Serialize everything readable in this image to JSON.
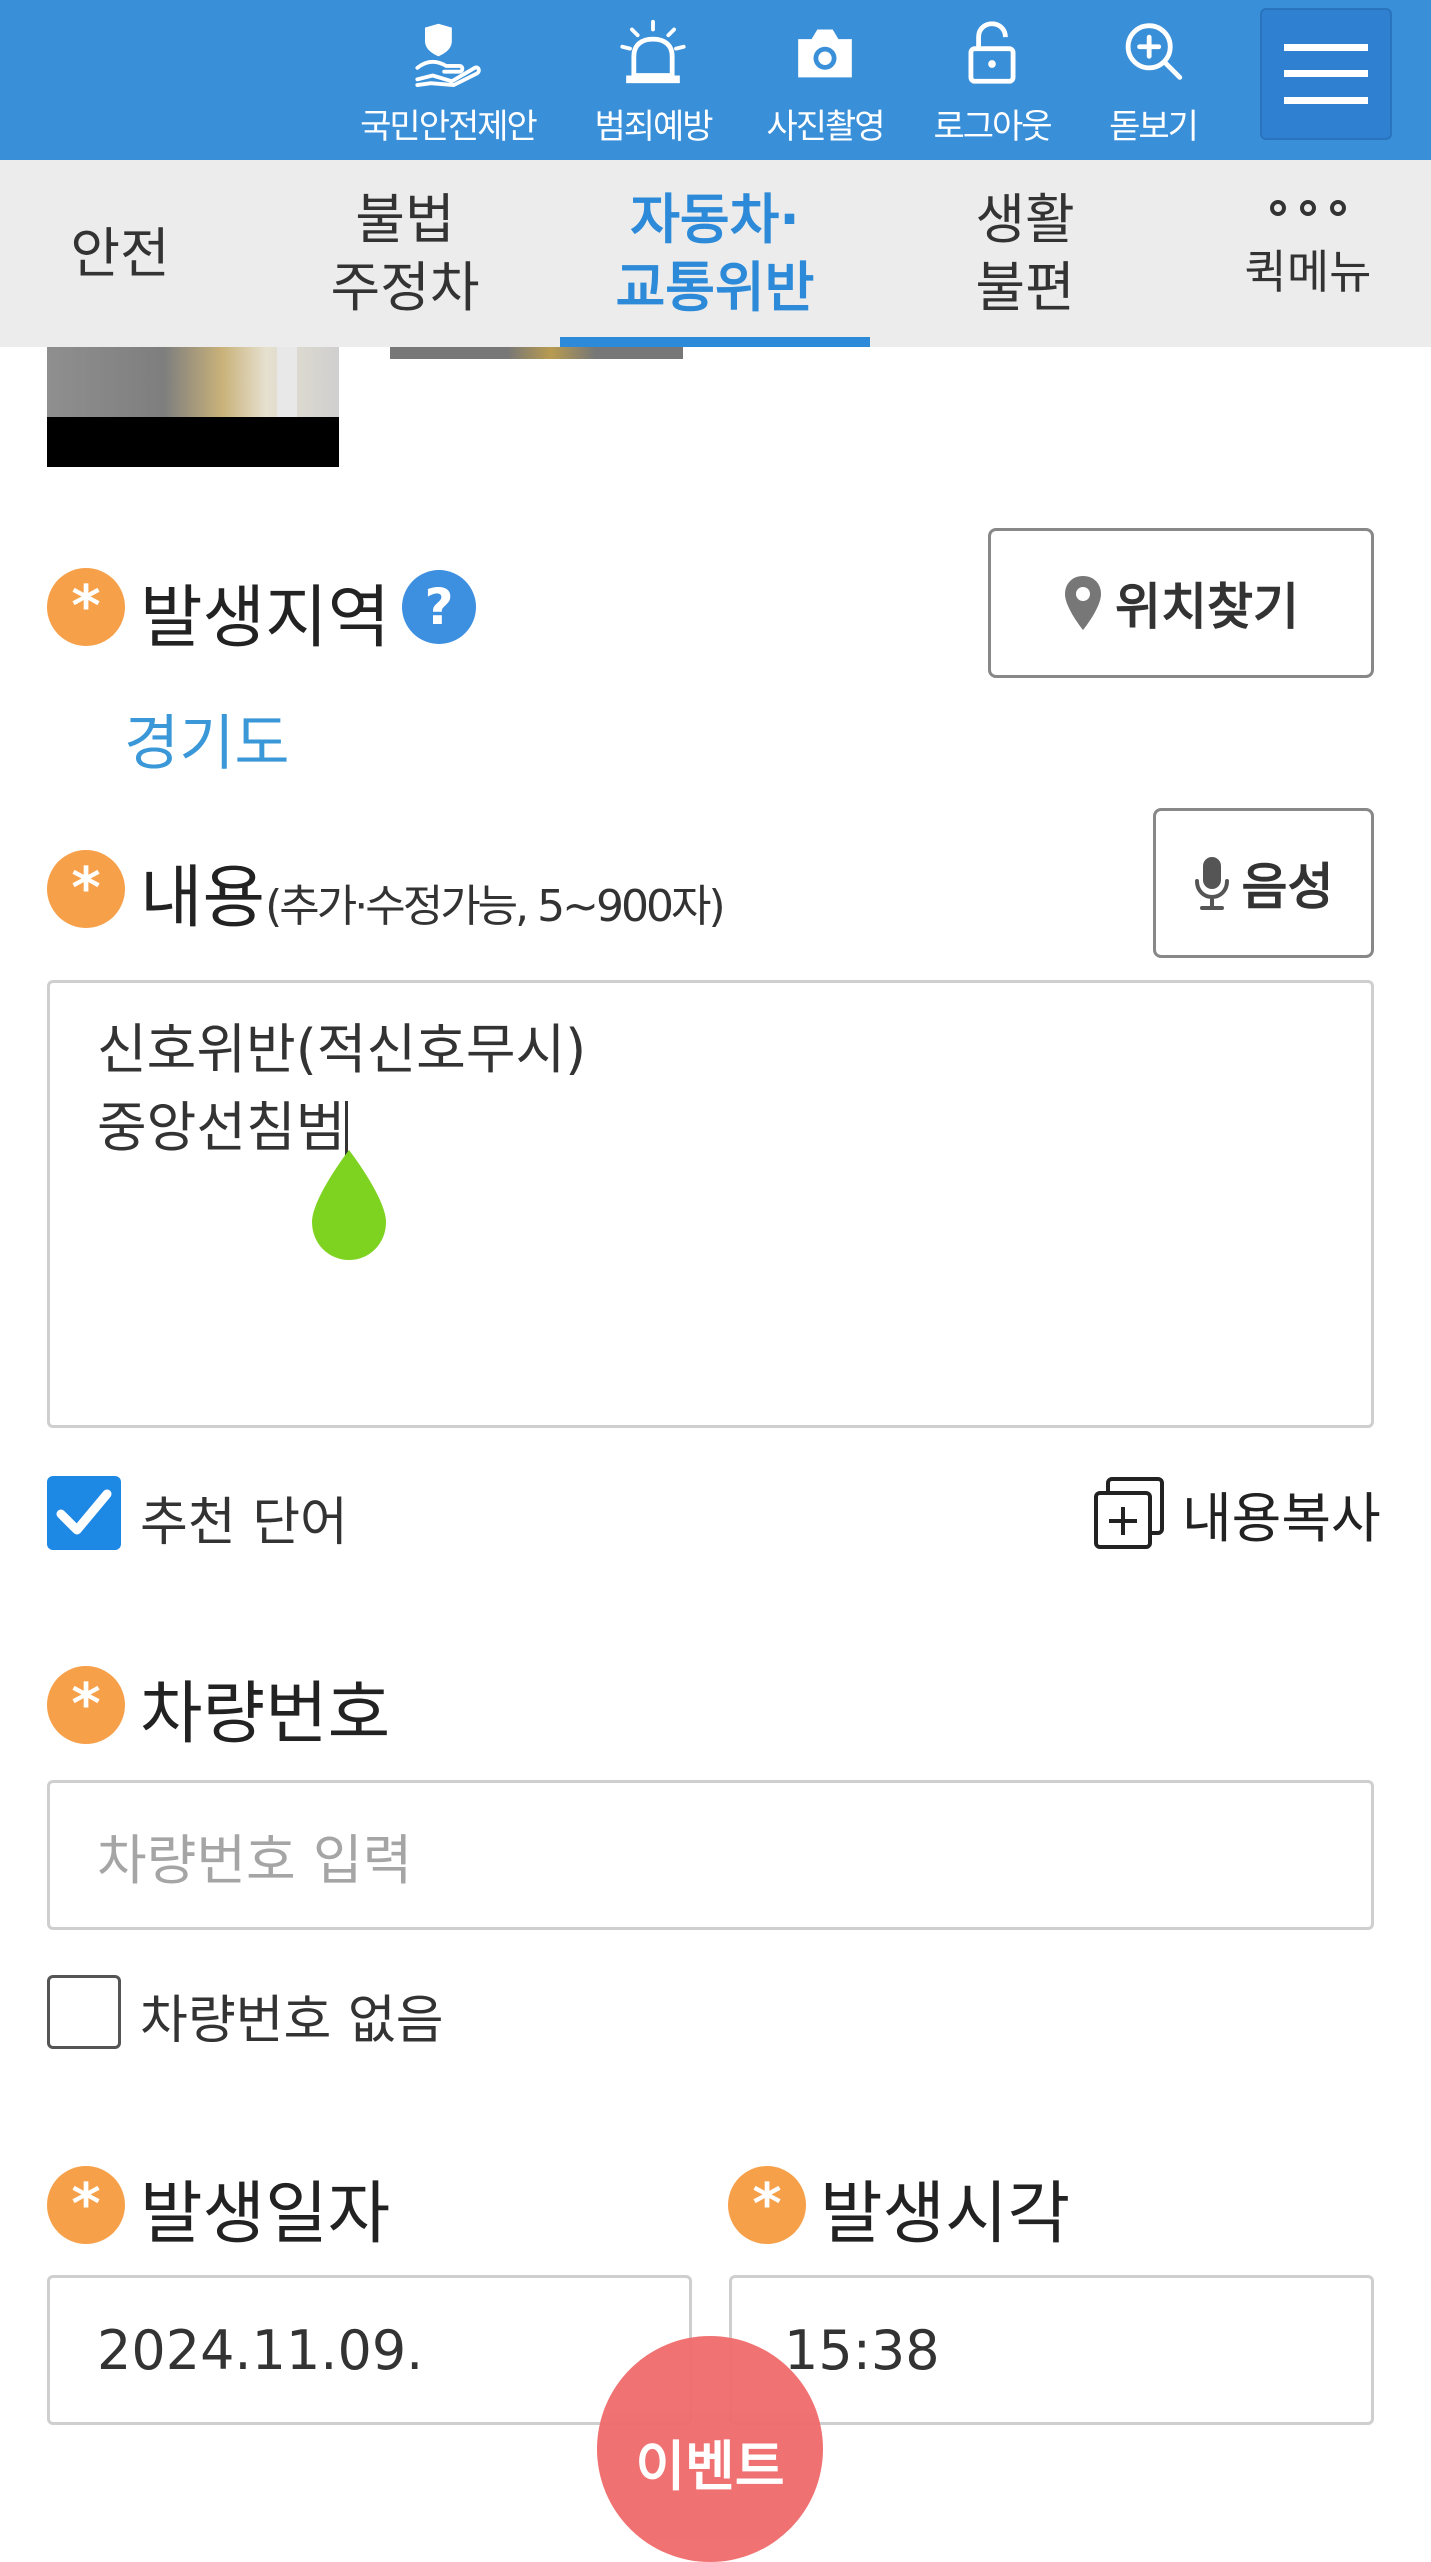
{
  "toolbar": {
    "items": [
      {
        "label": "국민안전제안",
        "icon": "hand-shield-icon"
      },
      {
        "label": "범죄예방",
        "icon": "siren-icon"
      },
      {
        "label": "사진촬영",
        "icon": "camera-icon"
      },
      {
        "label": "로그아웃",
        "icon": "unlock-icon"
      },
      {
        "label": "돋보기",
        "icon": "zoom-in-icon"
      }
    ],
    "menu_icon": "hamburger-menu-icon"
  },
  "tabs": [
    {
      "label": "안전"
    },
    {
      "label": "불법\n주정차"
    },
    {
      "label": "자동차·\n교통위반",
      "active": true
    },
    {
      "label": "생활\n불편"
    }
  ],
  "quick_menu": {
    "label": "퀵메뉴"
  },
  "region": {
    "title": "발생지역",
    "help": "?",
    "find_button": "위치찾기",
    "value": "경기도"
  },
  "content": {
    "title": "내용",
    "subtitle": "(추가·수정가능, 5~900자)",
    "voice_button": "음성",
    "lines": [
      "신호위반(적신호무시)",
      "중앙선침범"
    ]
  },
  "recommend": {
    "label": "추천 단어",
    "checked": true
  },
  "copy": {
    "label": "내용복사"
  },
  "vehicle": {
    "title": "차량번호",
    "placeholder": "차량번호 입력",
    "no_plate_label": "차량번호 없음",
    "no_plate_checked": false
  },
  "date": {
    "title": "발생일자",
    "value": "2024.11.09."
  },
  "time": {
    "title": "발생시각",
    "value": "15:38"
  },
  "event": {
    "label": "이벤트"
  },
  "colors": {
    "primary": "#3a8fd9",
    "tab_active": "#2c8ad8",
    "required": "#f7a04a",
    "region_text": "#3a98d8",
    "checkbox": "#1e88e5",
    "event": "#f06a6a"
  },
  "required_mark": "*"
}
